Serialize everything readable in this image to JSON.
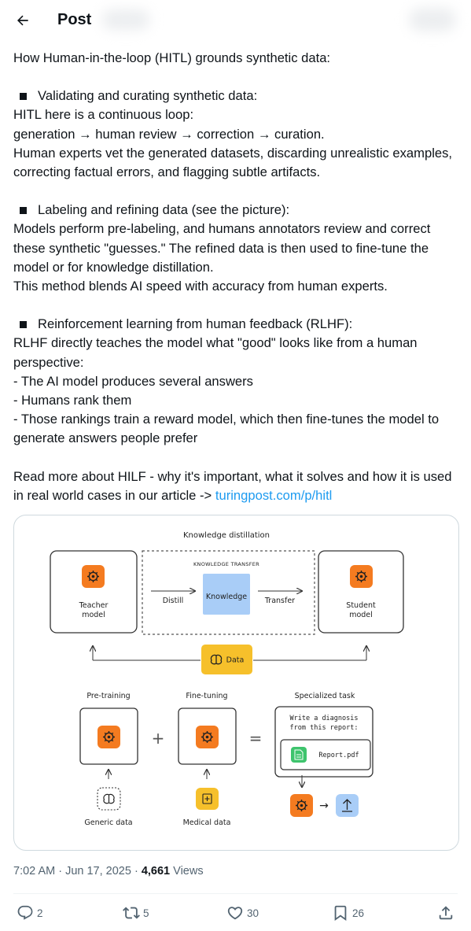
{
  "header": {
    "title": "Post"
  },
  "post": {
    "intro": "How Human-in-the-loop (HITL) grounds synthetic data:",
    "sections": [
      {
        "heading": "Validating and curating synthetic data:",
        "lines": [
          "HITL here is a continuous loop:",
          "generation → human review → correction → curation.",
          "Human experts vet the generated datasets, discarding unrealistic examples, correcting factual errors, and flagging subtle artifacts."
        ]
      },
      {
        "heading": "Labeling and refining data (see the picture):",
        "lines": [
          "Models perform pre-labeling, and humans annotators review and correct these synthetic \"guesses.\" The refined data is then used to fine-tune the model or for knowledge distillation.",
          "This method blends AI speed with accuracy from human experts."
        ]
      },
      {
        "heading": "Reinforcement learning from human feedback (RLHF):",
        "lines": [
          "RLHF directly teaches the model what \"good\" looks like from a human perspective:",
          "- The AI model produces several answers",
          "- Humans rank them",
          "- Those rankings train a reward model, which then fine-tunes the model to generate answers people prefer"
        ]
      }
    ],
    "outro": "Read more about HILF - why it's important, what it solves and how it is used in real world cases in our article ->",
    "link_text": "turingpost.com/p/hitl"
  },
  "diagram": {
    "kd_title": "Knowledge distillation",
    "kt_label": "KNOWLEDGE TRANSFER",
    "teacher_line1": "Teacher",
    "teacher_line2": "model",
    "distill": "Distill",
    "knowledge": "Knowledge",
    "transfer": "Transfer",
    "student_line1": "Student",
    "student_line2": "model",
    "data": "Data",
    "pretraining": "Pre-training",
    "finetuning": "Fine-tuning",
    "specialized": "Specialized task",
    "plus": "+",
    "equals": "=",
    "prompt_line1": "Write a diagnosis",
    "prompt_line2": "from this report:",
    "file": "Report.pdf",
    "arrow_right": "→",
    "generic_data": "Generic data",
    "medical_data": "Medical data",
    "colors": {
      "orange": "#f47b20",
      "blue": "#a9cdf7",
      "yellow": "#f6c02b",
      "green": "#3ec46d"
    }
  },
  "meta": {
    "time": "7:02 AM · Jun 17, 2025 ·",
    "views_count": "4,661",
    "views_label": "Views"
  },
  "actions": {
    "replies": "2",
    "reposts": "5",
    "likes": "30",
    "bookmarks": "26"
  },
  "icons": [
    "back-arrow-icon",
    "reply-icon",
    "repost-icon",
    "like-icon",
    "bookmark-icon",
    "share-icon"
  ]
}
